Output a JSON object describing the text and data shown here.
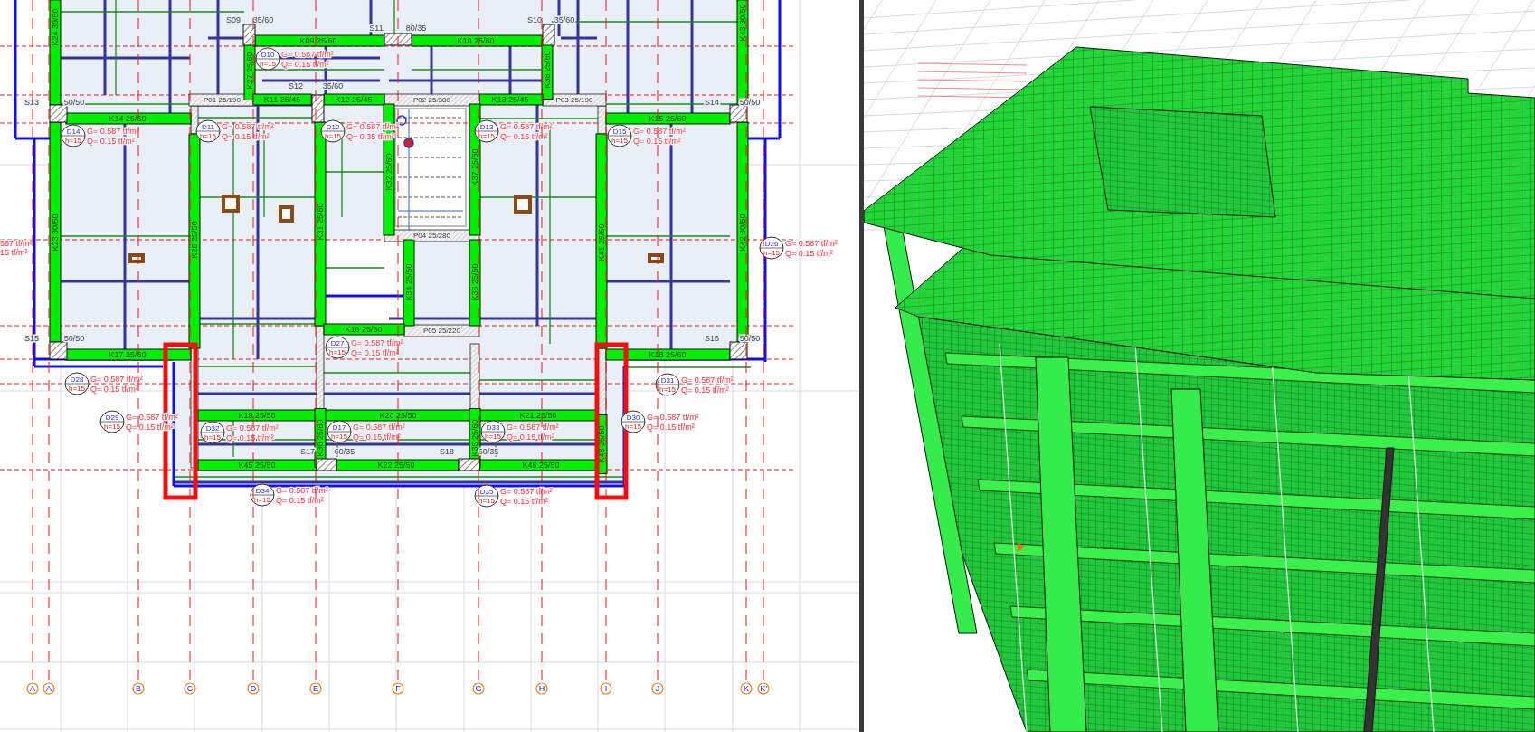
{
  "plan": {
    "beam_labels": [
      "K24 30/50",
      "K23 30/50",
      "K14 25/60",
      "K17 25/60",
      "K26 25/50",
      "K27 25/60",
      "K09 25/60",
      "K11 25/45",
      "K12 25/45",
      "K31 25/60",
      "K32 25/60",
      "K10 25/60",
      "K38 25/60",
      "K13 25/45",
      "K15 25/60",
      "K18 25/60",
      "K43 30/50",
      "K42 30/50",
      "K41 25/50",
      "K37 25/50",
      "K34 25/50",
      "K36 25/50",
      "K16 25/60",
      "K19 25/50",
      "K20 25/50",
      "K21 25/50",
      "K45 25/50",
      "K22 25/50",
      "K46 25/50",
      "K30 25/60",
      "K35 25/60",
      "K48 25/50"
    ],
    "wall_labels": [
      "P01 25/190",
      "P02 25/380",
      "P03 25/190",
      "P04 25/280",
      "P05 25/220"
    ],
    "marks": [
      "S09",
      "35/60",
      "S11",
      "80/35",
      "S10",
      "35/60",
      "S12",
      "35/60",
      "S13",
      "50/50",
      "S14",
      "50/50",
      "S15",
      "50/50",
      "S16",
      "50/50",
      "S17",
      "60/35",
      "S18",
      "60/35"
    ],
    "loads": [
      {
        "id": "D10",
        "thickness": "h=15",
        "g": "G= 0.587 tf/m²",
        "q": "Q= 0.15 tf/m²"
      },
      {
        "id": "D11",
        "thickness": "h=15",
        "g": "G= 0.587 tf/m²",
        "q": "Q= 0.15 tf/m²"
      },
      {
        "id": "D12",
        "thickness": "h=15",
        "g": "G= 0.587 tf/m²",
        "q": "Q= 0.35 tf/m²"
      },
      {
        "id": "D13",
        "thickness": "h=15",
        "g": "G= 0.587 tf/m²",
        "q": "Q= 0.15 tf/m²"
      },
      {
        "id": "D14",
        "thickness": "h=15",
        "g": "G= 0.587 tf/m²",
        "q": "Q= 0.15 tf/m²"
      },
      {
        "id": "D15",
        "thickness": "h=15",
        "g": "G= 0.587 tf/m²",
        "q": "Q= 0.15 tf/m²"
      },
      {
        "id": "D26",
        "thickness": "h=15",
        "g": "G= 0.587 tf/m²",
        "q": "Q= 0.15 tf/m²"
      },
      {
        "id": "D27",
        "thickness": "h=15",
        "g": "G= 0.587 tf/m²",
        "q": "Q= 0.15 tf/m²"
      },
      {
        "id": "D28",
        "thickness": "h=15",
        "g": "G= 0.587 tf/m²",
        "q": "Q= 0.15 tf/m²"
      },
      {
        "id": "D29",
        "thickness": "h=15",
        "g": "G= 0.587 tf/m²",
        "q": "Q= 0.15 tf/m²"
      },
      {
        "id": "D32",
        "thickness": "h=15",
        "g": "G= 0.587 tf/m²",
        "q": "Q= 0.15 tf/m²"
      },
      {
        "id": "D17",
        "thickness": "h=15",
        "g": "G= 0.587 tf/m²",
        "q": "Q= 0.15 tf/m²"
      },
      {
        "id": "D33",
        "thickness": "h=15",
        "g": "G= 0.587 tf/m²",
        "q": "Q= 0.15 tf/m²"
      },
      {
        "id": "D30",
        "thickness": "h=15",
        "g": "G= 0.587 tf/m²",
        "q": "Q= 0.15 tf/m²"
      },
      {
        "id": "D31",
        "thickness": "h=15",
        "g": "G= 0.587 tf/m²",
        "q": "Q= 0.15 tf/m²"
      },
      {
        "id": "D34",
        "thickness": "h=15",
        "g": "G= 0.587 tf/m²",
        "q": "Q= 0.15 tf/m²"
      },
      {
        "id": "D35",
        "thickness": "h=15",
        "g": "G= 0.587 tf/m²",
        "q": "Q= 0.15 tf/m²"
      }
    ],
    "cut_load": {
      "g": "587 tf/m²",
      "q": "15 tf/m²"
    },
    "axes": [
      {
        "label": "A"
      },
      {
        "label": "A"
      },
      {
        "label": "B"
      },
      {
        "label": "C"
      },
      {
        "label": "D"
      },
      {
        "label": "E"
      },
      {
        "label": "F"
      },
      {
        "label": "G"
      },
      {
        "label": "H"
      },
      {
        "label": "I"
      },
      {
        "label": "J"
      },
      {
        "label": "K"
      },
      {
        "label": "K'"
      }
    ]
  }
}
